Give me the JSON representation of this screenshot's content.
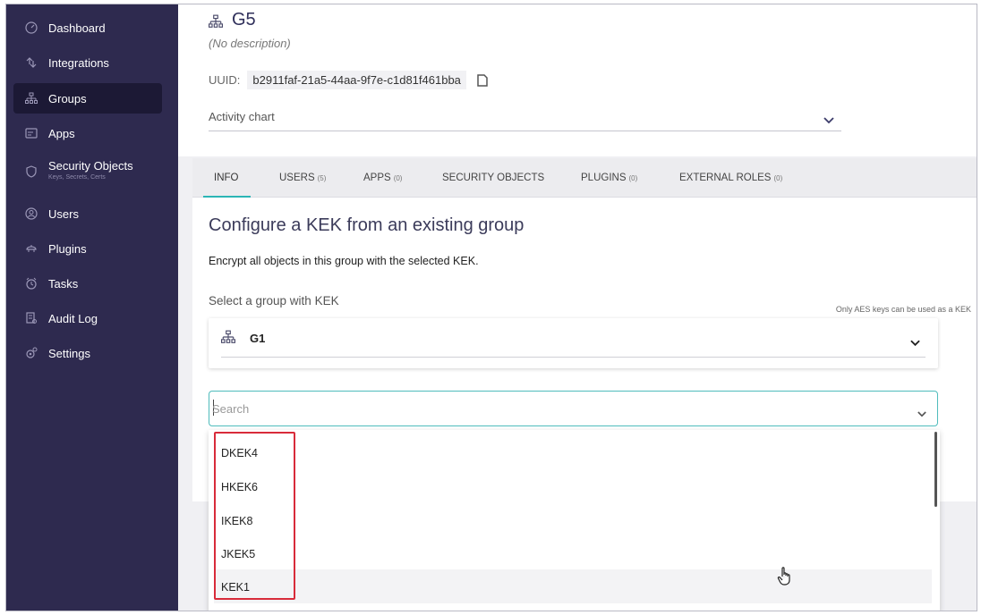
{
  "sidebar": {
    "items": [
      {
        "label": "Dashboard",
        "icon": "dashboard-icon",
        "active": false
      },
      {
        "label": "Integrations",
        "icon": "integrations-icon",
        "active": false
      },
      {
        "label": "Groups",
        "icon": "groups-icon",
        "active": true
      },
      {
        "label": "Apps",
        "icon": "apps-icon",
        "active": false
      },
      {
        "label": "Security Objects",
        "sublabel": "Keys, Secrets, Certs",
        "icon": "security-objects-icon",
        "active": false
      },
      {
        "label": "Users",
        "icon": "users-icon",
        "active": false
      },
      {
        "label": "Plugins",
        "icon": "plugins-icon",
        "active": false
      },
      {
        "label": "Tasks",
        "icon": "tasks-icon",
        "active": false
      },
      {
        "label": "Audit Log",
        "icon": "audit-log-icon",
        "active": false
      },
      {
        "label": "Settings",
        "icon": "settings-icon",
        "active": false
      }
    ]
  },
  "header": {
    "group_name": "G5",
    "description": "(No description)",
    "uuid_label": "UUID:",
    "uuid_value": "b2911faf-21a5-44aa-9f7e-c1d81f461bba",
    "activity_chart_label": "Activity chart"
  },
  "tabs": [
    {
      "label": "INFO",
      "count": "",
      "active": true
    },
    {
      "label": "USERS",
      "count": "(5)",
      "active": false
    },
    {
      "label": "APPS",
      "count": "(0)",
      "active": false
    },
    {
      "label": "SECURITY OBJECTS",
      "count": "",
      "active": false
    },
    {
      "label": "PLUGINS",
      "count": "(0)",
      "active": false
    },
    {
      "label": "EXTERNAL ROLES",
      "count": "(0)",
      "active": false
    }
  ],
  "kek": {
    "title": "Configure a KEK from an existing group",
    "description": "Encrypt all objects in this group with the selected KEK.",
    "select_label": "Select a group with KEK",
    "aes_note": "Only AES keys can be used as a KEK",
    "selected_group": "G1",
    "search_placeholder": "Search",
    "options": [
      "DKEK4",
      "HKEK6",
      "IKEK8",
      "JKEK5",
      "KEK1"
    ],
    "hovered_option": "KEK1"
  },
  "colors": {
    "sidebar_bg": "#2e2a4f",
    "accent": "#2bb5b5",
    "highlight": "#d82b3a"
  }
}
